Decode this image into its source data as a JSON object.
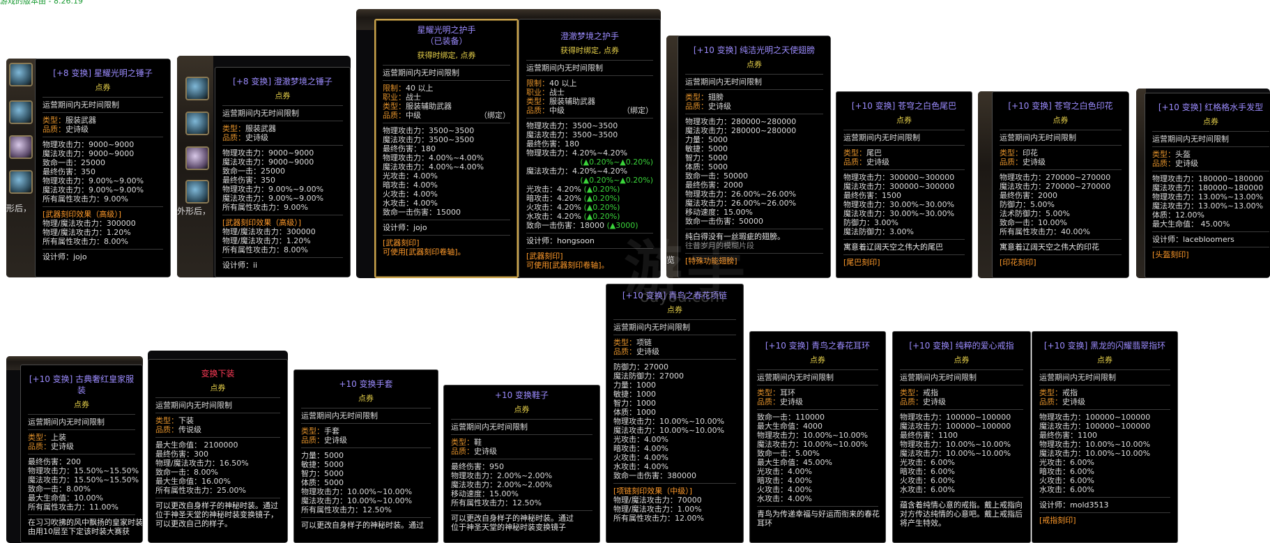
{
  "version_label": "游戏的版本由 - 8.26.19",
  "watermark": "游手",
  "watermark2": "ouyou.com",
  "bg_text": {
    "s1": "形后，",
    "s2": "外形后，",
    "s5": "览"
  },
  "t1": {
    "title": "[+8 变换] 星耀光明之锤子",
    "sub": "点券",
    "limit": "运营期间内无时间限制",
    "type_k": "类型：",
    "type_v": "服装武器",
    "grade_k": "品质：",
    "grade_v": "史诗级",
    "stats": [
      "物理攻击力：9000~9000",
      "魔法攻击力：9000~9000",
      "致命一击：25000",
      "最终伤害：350",
      "物理攻击力：9.00%~9.00%",
      "魔法攻击力：9.00%~9.00%",
      "所有属性攻击力：9.00%"
    ],
    "eng": "[武器刻印效果（高级）]",
    "eng_stats": [
      "物理/魔法攻击力：300000",
      "物理/魔法攻击力：1.20%",
      "所有属性攻击力：8.00%"
    ],
    "designer": "设计师：jojo"
  },
  "t2": {
    "title": "[+8 变换] 澄澈梦境之锤子",
    "sub": "点券",
    "limit": "运营期间内无时间限制",
    "type_k": "类型：",
    "type_v": "服装武器",
    "grade_k": "品质：",
    "grade_v": "史诗级",
    "stats": [
      "物理攻击力：9000~9000",
      "魔法攻击力：9000~9000",
      "致命一击：25000",
      "最终伤害：350",
      "物理攻击力：9.00%~9.00%",
      "魔法攻击力：9.00%~9.00%",
      "所有属性攻击力：9.00%"
    ],
    "eng": "[武器刻印效果（高级）]",
    "eng_stats": [
      "物理/魔法攻击力：300000",
      "物理/魔法攻击力：1.20%",
      "所有属性攻击力：8.00%"
    ],
    "designer": "设计师：ii"
  },
  "t3a": {
    "title": "星耀光明之护手",
    "title2": "（已装备）",
    "sub": "获得时绑定, 点券",
    "limit": "运营期间内无时间限制",
    "lim_k": "限制：",
    "lim_v": "40 以上",
    "job_k": "职业：",
    "job_v": "战士",
    "type_k": "类型：",
    "type_v": "服装辅助武器",
    "grade_k": "品质：",
    "grade_v": "中级",
    "bind": "（绑定）",
    "stats": [
      "物理攻击力：3500~3500",
      "魔法攻击力：3500~3500",
      "最终伤害：180",
      "物理攻击力：4.00%~4.00%",
      "魔法攻击力：4.00%~4.00%",
      "光攻击：4.00%",
      "暗攻击：4.00%",
      "火攻击：4.00%",
      "水攻击：4.00%",
      "致命一击伤害：15000"
    ],
    "designer": "设计师：jojo",
    "eng": "[武器刻印]",
    "eng_line": "可使用[武器刻印卷轴]。"
  },
  "t3b": {
    "title": "澄澈梦境之护手",
    "sub": "获得时绑定, 点券",
    "limit": "运营期间内无时间限制",
    "lim_k": "限制：",
    "lim_v": "40 以上",
    "job_k": "职业：",
    "job_v": "战士",
    "type_k": "类型：",
    "type_v": "服装辅助武器",
    "grade_k": "品质：",
    "grade_v": "中级",
    "bind": "（绑定）",
    "stats_a": [
      "物理攻击力：3500~3500",
      "魔法攻击力：3500~3500",
      "最终伤害：180",
      "物理攻击力：4.20%~4.20%"
    ],
    "diff1": "(▲0.20%~▲0.20%)",
    "stat_m": "魔法攻击力：4.20%~4.20%",
    "diff2": "(▲0.20%~▲0.20%)",
    "elem": [
      {
        "s": "光攻击：4.20%",
        "d": "(▲0.20%)"
      },
      {
        "s": "暗攻击：4.20%",
        "d": "(▲0.20%)"
      },
      {
        "s": "火攻击：4.20%",
        "d": "(▲0.20%)"
      },
      {
        "s": "水攻击：4.20%",
        "d": "(▲0.20%)"
      }
    ],
    "crit": "致命一击伤害：18000",
    "crit_d": "(▲3000)",
    "designer": "设计师：hongsoon",
    "eng": "[武器刻印]",
    "eng_line": "可使用[武器刻印卷轴]。"
  },
  "t4": {
    "title": "[+10 变换] 纯洁光明之天使翅膀",
    "sub": "点券",
    "limit": "运营期间内无时间限制",
    "type_k": "类型：",
    "type_v": "翅膀",
    "grade_k": "品质：",
    "grade_v": "史诗级",
    "stats": [
      "物理攻击力：280000~280000",
      "魔法攻击力：280000~280000",
      "力量：5000",
      "敏捷：5000",
      "智力：5000",
      "体质：5000",
      "致命一击：50000",
      "最终伤害：2000",
      "物理攻击力：26.00%~26.00%",
      "魔法攻击力：26.00%~26.00%",
      "移动速度：15.00%",
      "致命一击伤害：50000"
    ],
    "desc": "纯白得没有一丝瑕疵的翅膀。",
    "desc2": "往昔岁月的模糊片段",
    "eng": "[特殊功能翅膀]"
  },
  "t5": {
    "title": "[+10 变换] 苍穹之白色尾巴",
    "sub": "点券",
    "limit": "运营期间内无时间限制",
    "type_k": "类型：",
    "type_v": "尾巴",
    "grade_k": "品质：",
    "grade_v": "史诗级",
    "stats": [
      "物理攻击力：300000~300000",
      "魔法攻击力：300000~300000",
      "最终伤害：1500",
      "物理攻击力：30.00%~30.00%",
      "魔法攻击力：30.00%~30.00%",
      "防御力：3.00%",
      "魔法防御力：3.00%"
    ],
    "desc": "寓意着辽阔天空之伟大的尾巴",
    "eng": "[尾巴刻印]"
  },
  "t6": {
    "title": "[+10 变换] 苍穹之白色印花",
    "sub": "点券",
    "limit": "运营期间内无时间限制",
    "type_k": "类型：",
    "type_v": "印花",
    "grade_k": "品质：",
    "grade_v": "史诗级",
    "stats": [
      "物理攻击力：270000~270000",
      "魔法攻击力：270000~270000",
      "最终伤害：2000",
      "防御力：5.00%",
      "法术防御力：5.00%",
      "致命一击：10.00%",
      "所有属性攻击力：40.00%"
    ],
    "desc": "寓意着辽阔天空之伟大的印花",
    "eng": "[印花刻印]"
  },
  "t7": {
    "title": "[+10 变换] 红格格水手发型",
    "sub": "点券",
    "limit": "运营期间内无时间限制",
    "type_k": "类型：",
    "type_v": "头盔",
    "grade_k": "品质：",
    "grade_v": "史诗级",
    "stats": [
      "物理攻击力：180000~180000",
      "魔法攻击力：180000~180000",
      "物理攻击力：13.00%~13.00%",
      "魔法攻击力：13.00%~13.00%",
      "体质：12.00%",
      "最大生命值： 45.00%"
    ],
    "designer": "设计师：lacebloomers",
    "eng": "[头盔刻印]"
  },
  "b1": {
    "title": "[+10 变换] 古典奢红皇家服装",
    "sub": "点券",
    "limit": "运营期间内无时间限制",
    "type_k": "类型：",
    "type_v": "上装",
    "grade_k": "品质：",
    "grade_v": "史诗级",
    "stats": [
      "最终伤害：200",
      "物理攻击力：15.50%~15.50%",
      "魔法攻击力：15.50%~15.50%",
      "致命一击：8.00%",
      "最大生命值：10.00%",
      "所有属性攻击力：11.00%"
    ],
    "desc": "在习习吹拂的风中飘扬的皇家时装。",
    "desc2": "由用10层至下定该时装大赛获"
  },
  "b2": {
    "title": "变换下装",
    "sub": "点券",
    "limit": "运营期间内无时间限制",
    "type_k": "类型：",
    "type_v": "下装",
    "grade_k": "品质：",
    "grade_v": "传说级",
    "stats": [
      "最大生命值： 2100000",
      "最终伤害：300",
      "物理/魔法攻击力：16.50%",
      "致命一击：8.00%",
      "最大生命值：16.00%",
      "所有属性攻击力：25.00%"
    ],
    "desc": "可以更改自身样子的神秘时装。通过",
    "desc2": "位于神圣天堂的神秘时装变换镜子，",
    "desc3": "可以更改自己的样子。"
  },
  "b3": {
    "title": "+10 变换手套",
    "sub": "点券",
    "limit": "运营期间内无时间限制",
    "type_k": "类型：",
    "type_v": "手套",
    "grade_k": "品质：",
    "grade_v": "史诗级",
    "stats": [
      "力量：5000",
      "敏捷：5000",
      "智力：5000",
      "体质：5000",
      "物理攻击力：10.00%~10.00%",
      "魔法攻击力：10.00%~10.00%",
      "所有属性攻击力：12.50%"
    ],
    "desc": "可以更改自身样子的神秘时装。通过"
  },
  "b4": {
    "title": "+10 变换鞋子",
    "sub": "点券",
    "limit": "运营期间内无时间限制",
    "type_k": "类型：",
    "type_v": "鞋",
    "grade_k": "品质：",
    "grade_v": "史诗级",
    "stats": [
      "最终伤害：950",
      "物理攻击力：2.00%~2.00%",
      "魔法攻击力：2.00%~2.00%",
      "移动速度：15.00%",
      "所有属性攻击力：12.50%"
    ],
    "desc": "可以更改自身样子的神秘时装。通过",
    "desc2": "位于神圣天堂的神秘时装变换镜子"
  },
  "b5": {
    "title": "[+10 变换] 青鸟之春花项链",
    "sub": "点券",
    "limit": "运营期间内无时间限制",
    "type_k": "类型：",
    "type_v": "项链",
    "grade_k": "品质：",
    "grade_v": "史诗级",
    "stats": [
      "防御力：27000",
      "魔法防御力：27000",
      "力量：1000",
      "敏捷：1000",
      "智力：1000",
      "体质：1000",
      "物理攻击力：10.00%~10.00%",
      "魔法攻击力：10.00%~10.00%",
      "光攻击：4.00%",
      "暗攻击：4.00%",
      "火攻击：4.00%",
      "水攻击：4.00%",
      "致命一击伤害：380000"
    ],
    "eng": "[项链刻印效果（中级）]",
    "eng_stats": [
      "物理/魔法攻击力：70000",
      "物理/魔法攻击力：1.00%",
      "所有属性攻击力：12.00%"
    ]
  },
  "b6": {
    "title": "[+10 变换] 青鸟之春花耳环",
    "sub": "点券",
    "limit": "运营期间内无时间限制",
    "type_k": "类型：",
    "type_v": "耳环",
    "grade_k": "品质：",
    "grade_v": "史诗级",
    "stats": [
      "致命一击：110000",
      "最大生命值：4000",
      "物理攻击力：10.00%~10.00%",
      "魔法攻击力：10.00%~10.00%",
      "致命一击：5.00%",
      "最大生命值：45.00%",
      "光攻击：4.00%",
      "暗攻击：4.00%",
      "火攻击：4.00%",
      "水攻击：4.00%"
    ],
    "desc": "青鸟为传递幸福与好运而衔来的春花",
    "desc2": "耳环"
  },
  "b7": {
    "title": "[+10 变换] 纯粹的爱心戒指",
    "sub": "点券",
    "limit": "运营期间内无时间限制",
    "type_k": "类型：",
    "type_v": "戒指",
    "grade_k": "品质：",
    "grade_v": "史诗级",
    "stats": [
      "物理攻击力：100000~100000",
      "魔法攻击力：100000~100000",
      "最终伤害：1100",
      "物理攻击力：10.00%~10.00%",
      "魔法攻击力：10.00%~10.00%",
      "光攻击：6.00%",
      "暗攻击：6.00%",
      "火攻击：6.00%",
      "水攻击：6.00%"
    ],
    "desc": "蕴含着纯情心意的戒指。戴上戒指向",
    "desc2": "对方传达纯情的心意吧。戴上戒指后",
    "desc3": "将产生特效。"
  },
  "b8": {
    "title": "[+10 变换] 黑龙的闪耀翡翠指环",
    "sub": "点券",
    "limit": "运营期间内无时间限制",
    "type_k": "类型：",
    "type_v": "戒指",
    "grade_k": "品质：",
    "grade_v": "史诗级",
    "stats": [
      "物理攻击力：100000~100000",
      "魔法攻击力：100000~100000",
      "最终伤害：1100",
      "物理攻击力：10.00%~10.00%",
      "魔法攻击力：10.00%~10.00%",
      "光攻击：6.00%",
      "暗攻击：6.00%",
      "火攻击：6.00%",
      "水攻击：6.00%"
    ],
    "designer": "设计师：mold3513",
    "eng": "[戒指刻印]"
  }
}
